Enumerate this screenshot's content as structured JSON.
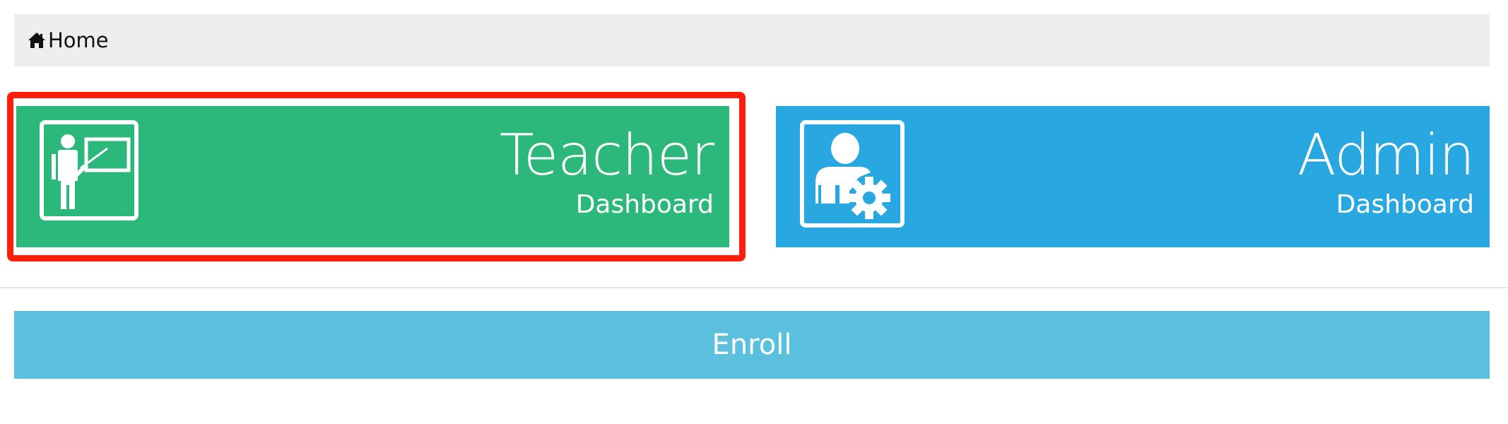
{
  "breadcrumb": {
    "home_label": "Home",
    "icon": "home-icon"
  },
  "cards": {
    "teacher": {
      "title": "Teacher",
      "subtitle": "Dashboard",
      "icon": "teacher-board-icon",
      "color": "#2bb87a"
    },
    "admin": {
      "title": "Admin",
      "subtitle": "Dashboard",
      "icon": "admin-user-gear-icon",
      "color": "#29a7e1"
    }
  },
  "highlight": {
    "color": "#ff1e0a"
  },
  "enroll": {
    "label": "Enroll",
    "color": "#5bc0de"
  }
}
